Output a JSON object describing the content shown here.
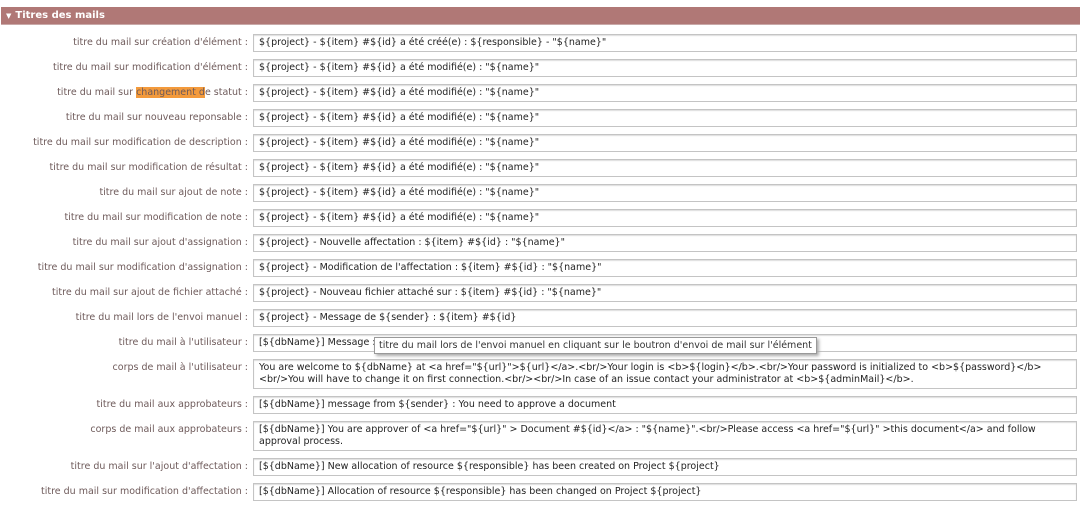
{
  "section_title": "Titres des mails",
  "rows": [
    {
      "label": "titre du mail sur création d'élément :",
      "value": "${project} - ${item} #${id} a été créé(e) : ${responsible} - \"${name}\""
    },
    {
      "label": "titre du mail sur modification d'élément :",
      "value": "${project} - ${item} #${id} a été modifié(e) : \"${name}\""
    },
    {
      "label_pre": "titre du mail sur ",
      "label_hl": "changement d",
      "label_post": "e statut :",
      "value": "${project} - ${item} #${id} a été modifié(e) : \"${name}\""
    },
    {
      "label": "titre du mail sur nouveau reponsable :",
      "value": "${project} - ${item} #${id} a été modifié(e) : \"${name}\""
    },
    {
      "label": "titre du mail sur modification de description :",
      "value": "${project} - ${item} #${id} a été modifié(e) : \"${name}\""
    },
    {
      "label": "titre du mail sur modification de résultat :",
      "value": "${project} - ${item} #${id} a été modifié(e) : \"${name}\""
    },
    {
      "label": "titre du mail sur ajout de note :",
      "value": "${project} - ${item} #${id} a été modifié(e) : \"${name}\""
    },
    {
      "label": "titre du mail sur modification de note :",
      "value": "${project} - ${item} #${id} a été modifié(e) : \"${name}\""
    },
    {
      "label": "titre du mail sur ajout d'assignation :",
      "value": "${project} - Nouvelle affectation : ${item} #${id} : \"${name}\""
    },
    {
      "label": "titre du mail sur modification d'assignation :",
      "value": "${project} - Modification de l'affectation : ${item} #${id} : \"${name}\""
    },
    {
      "label": "titre du mail sur ajout de fichier attaché :",
      "value": "${project} - Nouveau fichier attaché sur : ${item} #${id} : \"${name}\""
    },
    {
      "label": "titre du mail lors de l'envoi manuel :",
      "value": "${project} - Message de ${sender} : ${item} #${id}"
    },
    {
      "label": "titre du mail à l'utilisateur :",
      "value": "[${dbName}] Message : ${sender} : vos informations utilisateur"
    },
    {
      "label": "corps de mail à l'utilisateur :",
      "value": "You are welcome to ${dbName} at <a href=\"${url}\">${url}</a>.<br/>Your login is <b>${login}</b>.<br/>Your password is initialized to <b>${password}</b><br/>You will have to change it on first connection.<br/><br/>In case of an issue contact your administrator at <b>${adminMail}</b>."
    },
    {
      "label": "titre du mail aux approbateurs :",
      "value": "[${dbName}] message from ${sender} : You need to approve a document"
    },
    {
      "label": "corps de mail aux approbateurs :",
      "value": "[${dbName}] You are approver of <a href=\"${url}\" > Document #${id}</a> : \"${name}\".<br/>Please access <a href=\"${url}\" >this document</a> and follow approval process."
    },
    {
      "label": "titre du mail sur l'ajout d'affectation :",
      "value": "[${dbName}] New allocation of resource ${responsible} has been created on Project ${project}"
    },
    {
      "label": "titre du mail sur modification d'affectation :",
      "value": "[${dbName}] Allocation of resource ${responsible} has been changed on Project ${project}"
    }
  ],
  "tooltip": "titre du mail lors de l'envoi manuel en cliquant sur le boutron d'envoi de mail sur l'élément"
}
